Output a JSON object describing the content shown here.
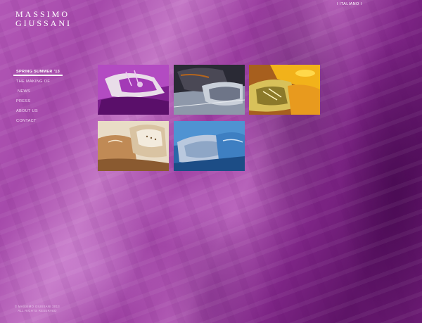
{
  "brand": {
    "line1": "MASSIMO",
    "line2": "GIUSSANI"
  },
  "language_link": "I  ITALIANO  I",
  "nav": {
    "items": [
      {
        "label": "SPRING SUMMER '13",
        "active": true
      },
      {
        "label": "THE MAKING OF"
      },
      {
        "label": "NEWS"
      },
      {
        "label": "PRESS"
      },
      {
        "label": "ABOUT US"
      },
      {
        "label": "CONTACT"
      }
    ]
  },
  "footer": {
    "line1": "© MASSIMO GIUSSANI 2013",
    "line2": "ALL RIGHTS RESERVED"
  },
  "colors": {
    "text": "#ffffff",
    "background_accent": "#a64aab"
  }
}
